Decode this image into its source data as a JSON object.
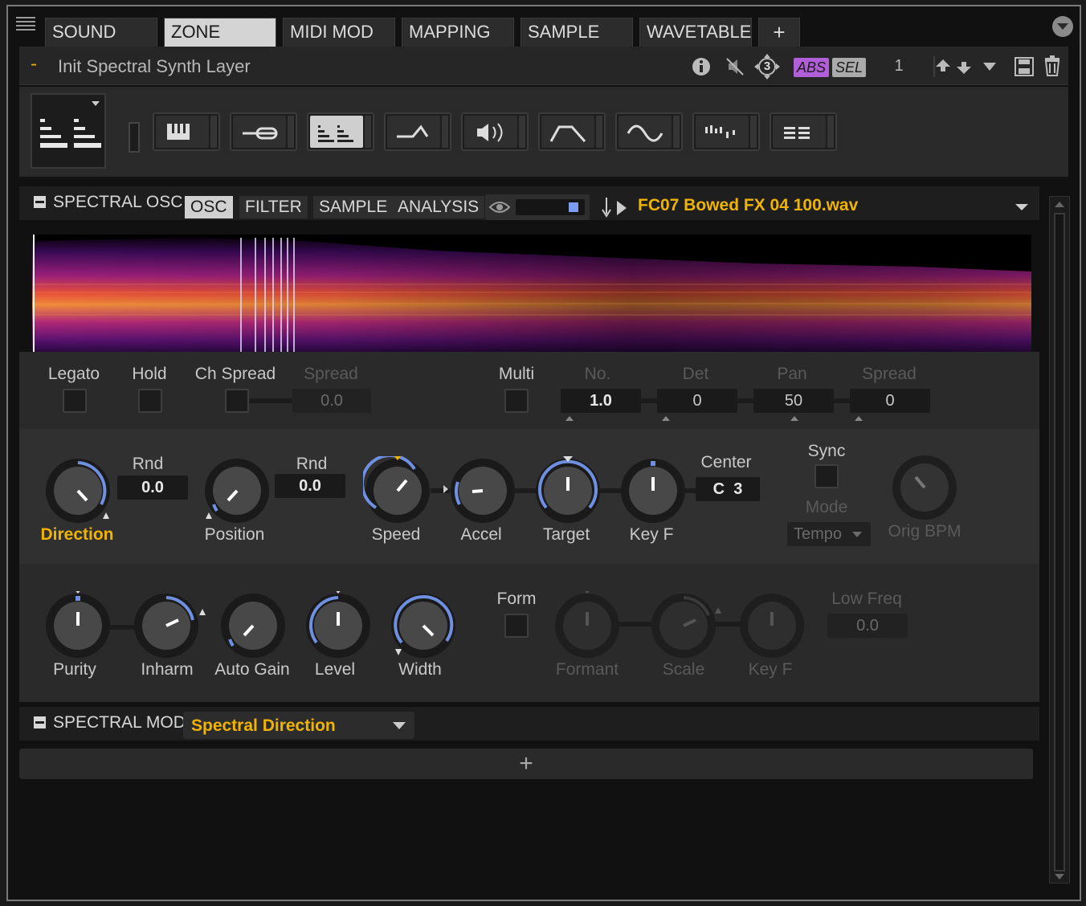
{
  "tabs": [
    {
      "label": "SOUND",
      "active": false
    },
    {
      "label": "ZONE",
      "active": true
    },
    {
      "label": "MIDI MOD",
      "active": false
    },
    {
      "label": "MAPPING",
      "active": false
    },
    {
      "label": "SAMPLE",
      "active": false
    },
    {
      "label": "WAVETABLE",
      "active": false
    }
  ],
  "add_tab_label": "+",
  "layer": {
    "dash": "-",
    "name": "Init Spectral Synth Layer",
    "voice_badge": "3",
    "abs_label": "ABS",
    "sel_label": "SEL",
    "number": "1"
  },
  "spectral_osc": {
    "title": "SPECTRAL OSC",
    "subtabs": [
      {
        "label": "OSC",
        "active": true
      },
      {
        "label": "FILTER",
        "active": false
      },
      {
        "label": "SAMPLE",
        "active": false
      },
      {
        "label": "ANALYSIS",
        "active": false
      }
    ],
    "filename": "FC07 Bowed FX 04 100.wav"
  },
  "row1": {
    "legato": "Legato",
    "hold": "Hold",
    "ch_spread": "Ch Spread",
    "spread": "Spread",
    "spread_value": "0.0",
    "multi": "Multi",
    "no": "No.",
    "no_value": "1.0",
    "det": "Det",
    "det_value": "0",
    "pan": "Pan",
    "pan_value": "50",
    "spread2": "Spread",
    "spread2_value": "0"
  },
  "row2": {
    "direction": "Direction",
    "rnd1": "Rnd",
    "rnd1_value": "0.0",
    "position": "Position",
    "rnd2": "Rnd",
    "rnd2_value": "0.0",
    "speed": "Speed",
    "accel": "Accel",
    "target": "Target",
    "keyf": "Key F",
    "center": "Center",
    "center_value": "C  3",
    "sync": "Sync",
    "mode": "Mode",
    "mode_value": "Tempo",
    "orig_bpm": "Orig BPM"
  },
  "row3": {
    "purity": "Purity",
    "inharm": "Inharm",
    "auto_gain": "Auto Gain",
    "level": "Level",
    "width": "Width",
    "form": "Form",
    "formant": "Formant",
    "scale": "Scale",
    "keyf": "Key F",
    "low_freq": "Low Freq",
    "low_freq_value": "0.0"
  },
  "spectral_mod": {
    "title": "SPECTRAL MOD",
    "selected": "Spectral Direction"
  },
  "add_label": "+",
  "colors": {
    "accent": "#f0b400",
    "knob_arc": "#6f8fe0",
    "abs_badge": "#b05fd8",
    "panel": "#2a2a2a"
  }
}
